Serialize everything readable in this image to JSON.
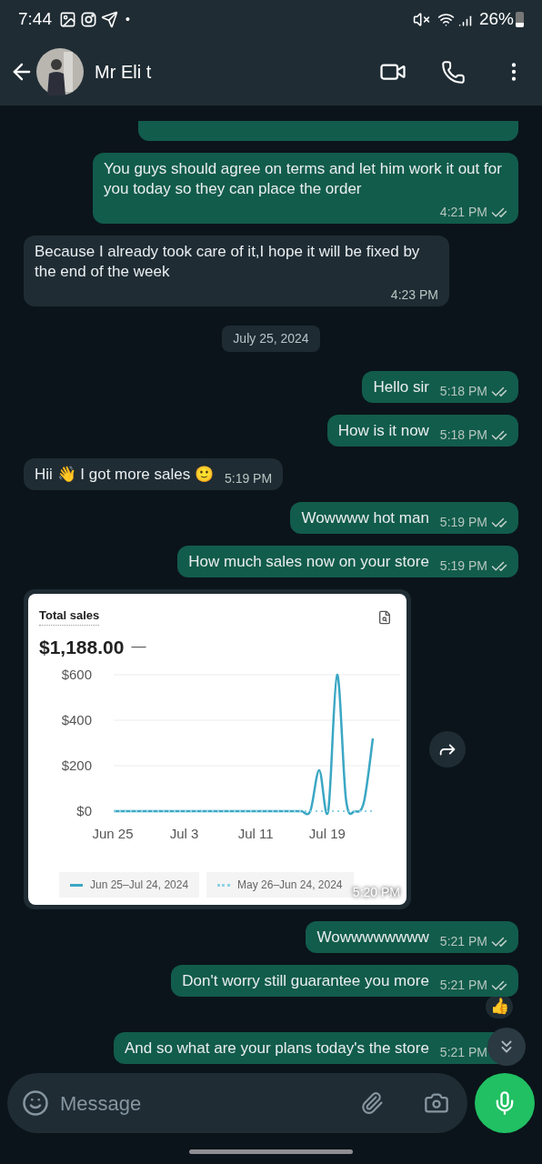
{
  "status_bar": {
    "time": "7:44",
    "dot": "•",
    "battery": "26%"
  },
  "header": {
    "name": "Mr Eli t"
  },
  "messages": [
    {
      "kind": "cut"
    },
    {
      "kind": "out",
      "text": "You guys should agree on terms and let him work it out for you today so they can place the order",
      "time": "4:21 PM",
      "ticks": true
    },
    {
      "kind": "in",
      "text": "Because I already took care of it,I hope it will be fixed by the end of the week",
      "time": "4:23 PM"
    },
    {
      "kind": "date",
      "text": "July 25, 2024"
    },
    {
      "kind": "out",
      "text": "Hello sir",
      "time": "5:18 PM",
      "ticks": true
    },
    {
      "kind": "out",
      "text": "How is it now",
      "time": "5:18 PM",
      "ticks": true
    },
    {
      "kind": "in",
      "text": "Hii 👋 I got more sales 🙂",
      "time": "5:19 PM"
    },
    {
      "kind": "out",
      "text": "Wowwww hot man",
      "time": "5:19 PM",
      "ticks": true
    },
    {
      "kind": "out",
      "text": "How much sales now on your store",
      "time": "5:19 PM",
      "ticks": true
    },
    {
      "kind": "image",
      "time": "5:20 PM",
      "card": {
        "title": "Total sales",
        "amount": "$1,188.00",
        "amount_suffix": "—",
        "chart_data": {
          "type": "line",
          "categories": [
            "Jun 25",
            null,
            null,
            null,
            null,
            null,
            null,
            null,
            "Jul 3",
            null,
            null,
            null,
            null,
            null,
            null,
            null,
            "Jul 11",
            null,
            null,
            null,
            null,
            null,
            null,
            null,
            "Jul 19",
            null,
            null,
            null,
            null,
            null
          ],
          "series": [
            {
              "name": "Jun 25–Jul 24, 2024",
              "color": "#3ba7c4",
              "line_style": "solid",
              "values": [
                0,
                0,
                0,
                0,
                0,
                0,
                0,
                0,
                0,
                0,
                0,
                0,
                0,
                0,
                0,
                0,
                0,
                0,
                0,
                0,
                0,
                0,
                0,
                180,
                0,
                600,
                50,
                0,
                40,
                320
              ]
            },
            {
              "name": "May 26–Jun 24, 2024",
              "color": "#8ed3e4",
              "line_style": "dotted",
              "values": [
                0,
                0,
                0,
                0,
                0,
                0,
                0,
                0,
                0,
                0,
                0,
                0,
                0,
                0,
                0,
                0,
                0,
                0,
                0,
                0,
                0,
                0,
                0,
                0,
                0,
                0,
                0,
                0,
                0,
                0
              ]
            }
          ],
          "ylim": [
            0,
            600
          ],
          "yticks": [
            {
              "value": 0,
              "label": "$0"
            },
            {
              "value": 200,
              "label": "$200"
            },
            {
              "value": 400,
              "label": "$400"
            },
            {
              "value": 600,
              "label": "$600"
            }
          ]
        }
      }
    },
    {
      "kind": "out",
      "text": "Wowwwwwwww",
      "time": "5:21 PM",
      "ticks": true
    },
    {
      "kind": "out",
      "text": "Don't worry still guarantee you more",
      "time": "5:21 PM",
      "ticks": true,
      "reaction": "👍"
    },
    {
      "kind": "out",
      "text": "And so what are your plans today's the store",
      "time": "5:21 PM",
      "ticks": false
    }
  ],
  "composer": {
    "placeholder": "Message"
  }
}
